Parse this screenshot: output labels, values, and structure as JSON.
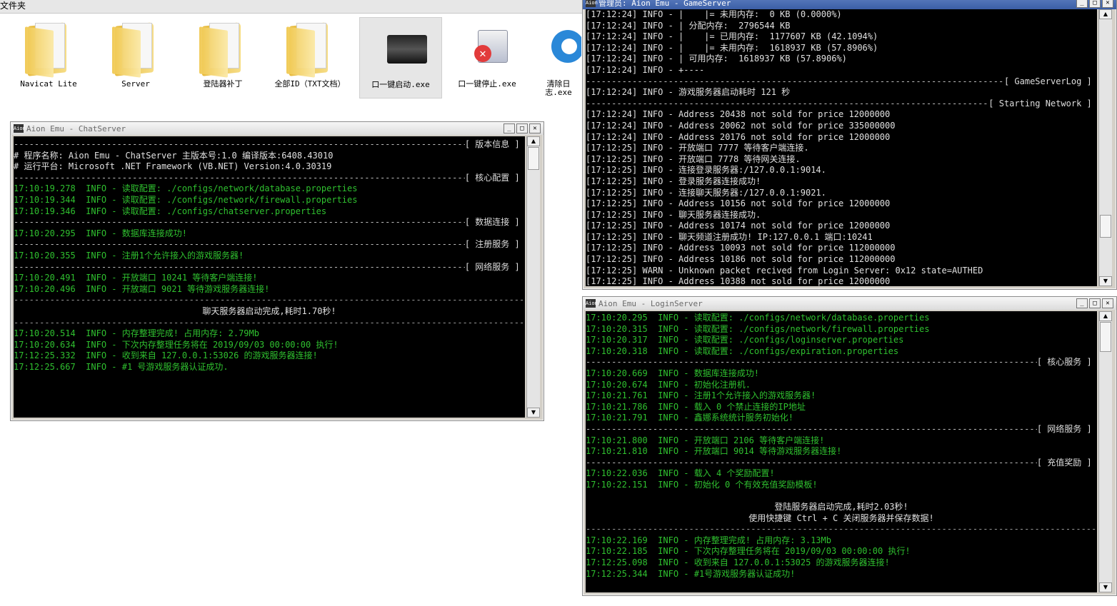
{
  "explorer": {
    "title": "文件夹",
    "icons": [
      {
        "label": "Navicat Lite",
        "kind": "folder"
      },
      {
        "label": "Server",
        "kind": "folder"
      },
      {
        "label": "登陆器补丁",
        "kind": "folder"
      },
      {
        "label": "全部ID（TXT文档）",
        "kind": "folder"
      },
      {
        "label": "口一键启动.exe",
        "kind": "servers-exe",
        "selected": true
      },
      {
        "label": "口一键停止.exe",
        "kind": "stop-exe"
      },
      {
        "label": "清除日志.exe",
        "kind": "blue-exe"
      }
    ]
  },
  "chat_window": {
    "title": "Aion Emu - ChatServer",
    "lines": [
      {
        "t": "sec",
        "text": "版本信息"
      },
      {
        "t": "txt",
        "text": "# 程序名称: Aion Emu - ChatServer 主版本号:1.0 编译版本:6408.43010"
      },
      {
        "t": "txt",
        "text": "# 运行平台: Microsoft .NET Framework (VB.NET) Version:4.0.30319"
      },
      {
        "t": "sec",
        "text": "核心配置"
      },
      {
        "t": "g",
        "text": "17:10:19.278  INFO - 读取配置: ./configs/network/database.properties"
      },
      {
        "t": "g",
        "text": "17:10:19.344  INFO - 读取配置: ./configs/network/firewall.properties"
      },
      {
        "t": "g",
        "text": "17:10:19.346  INFO - 读取配置: ./configs/chatserver.properties"
      },
      {
        "t": "sec",
        "text": "数据连接"
      },
      {
        "t": "g",
        "text": "17:10:20.295  INFO - 数据库连接成功!"
      },
      {
        "t": "sec",
        "text": "注册服务"
      },
      {
        "t": "g",
        "text": "17:10:20.355  INFO - 注册1个允许接入的游戏服务器!"
      },
      {
        "t": "sec",
        "text": "网络服务"
      },
      {
        "t": "g",
        "text": "17:10:20.491  INFO - 开放端口 10241 等待客户端连接!"
      },
      {
        "t": "g",
        "text": "17:10:20.496  INFO - 开放端口 9021 等待游戏服务器连接!"
      },
      {
        "t": "sep",
        "text": ""
      },
      {
        "t": "ctr",
        "text": "聊天服务器启动完成,耗时1.70秒!"
      },
      {
        "t": "sep",
        "text": ""
      },
      {
        "t": "g",
        "text": "17:10:20.514  INFO - 内存整理完成! 占用内存: 2.79Mb"
      },
      {
        "t": "g",
        "text": "17:10:20.634  INFO - 下次内存整理任务将在 2019/09/03 00:00:00 执行!"
      },
      {
        "t": "g",
        "text": "17:12:25.332  INFO - 收到来自 127.0.0.1:53026 的游戏服务器连接!"
      },
      {
        "t": "g",
        "text": "17:12:25.667  INFO - #1 号游戏服务器认证成功."
      }
    ]
  },
  "game_window": {
    "title": "管理员: Aion Emu - GameServer",
    "lines": [
      {
        "t": "txt",
        "text": "[17:12:24] INFO - |    |= 未用内存:  0 KB (0.0000%)"
      },
      {
        "t": "txt",
        "text": "[17:12:24] INFO - | 分配内存:  2796544 KB"
      },
      {
        "t": "txt",
        "text": "[17:12:24] INFO - |    |= 已用内存:  1177607 KB (42.1094%)"
      },
      {
        "t": "txt",
        "text": "[17:12:24] INFO - |    |= 未用内存:  1618937 KB (57.8906%)"
      },
      {
        "t": "txt",
        "text": "[17:12:24] INFO - | 可用内存:  1618937 KB (57.8906%)"
      },
      {
        "t": "txt",
        "text": "[17:12:24] INFO - +----"
      },
      {
        "t": "sec",
        "text": "GameServerLog"
      },
      {
        "t": "txt",
        "text": "[17:12:24] INFO - 游戏服务器启动耗时 121 秒"
      },
      {
        "t": "sec",
        "text": "Starting Network"
      },
      {
        "t": "txt",
        "text": "[17:12:24] INFO - Address 20438 not sold for price 12000000"
      },
      {
        "t": "txt",
        "text": "[17:12:24] INFO - Address 20062 not sold for price 335000000"
      },
      {
        "t": "txt",
        "text": "[17:12:24] INFO - Address 20176 not sold for price 12000000"
      },
      {
        "t": "txt",
        "text": "[17:12:25] INFO - 开放端口 7777 等待客户端连接."
      },
      {
        "t": "txt",
        "text": "[17:12:25] INFO - 开放端口 7778 等待网关连接."
      },
      {
        "t": "txt",
        "text": "[17:12:25] INFO - 连接登录服务器:/127.0.0.1:9014."
      },
      {
        "t": "txt",
        "text": "[17:12:25] INFO - 登录服务器连接成功!"
      },
      {
        "t": "txt",
        "text": "[17:12:25] INFO - 连接聊天服务器:/127.0.0.1:9021."
      },
      {
        "t": "txt",
        "text": "[17:12:25] INFO - Address 10156 not sold for price 12000000"
      },
      {
        "t": "txt",
        "text": "[17:12:25] INFO - 聊天服务器连接成功."
      },
      {
        "t": "txt",
        "text": "[17:12:25] INFO - Address 10174 not sold for price 12000000"
      },
      {
        "t": "txt",
        "text": "[17:12:25] INFO - 聊天频道注册成功! IP:127.0.0.1 端口:10241"
      },
      {
        "t": "txt",
        "text": "[17:12:25] INFO - Address 10093 not sold for price 112000000"
      },
      {
        "t": "txt",
        "text": "[17:12:25] INFO - Address 10186 not sold for price 112000000"
      },
      {
        "t": "txt",
        "text": "[17:12:25] WARN - Unknown packet recived from Login Server: 0x12 state=AUTHED"
      },
      {
        "t": "txt",
        "text": "[17:12:25] INFO - Address 10388 not sold for price 12000000"
      }
    ]
  },
  "login_window": {
    "title": "Aion Emu - LoginServer",
    "lines": [
      {
        "t": "g",
        "text": "17:10:20.295  INFO - 读取配置: ./configs/network/database.properties"
      },
      {
        "t": "g",
        "text": "17:10:20.315  INFO - 读取配置: ./configs/network/firewall.properties"
      },
      {
        "t": "g",
        "text": "17:10:20.317  INFO - 读取配置: ./configs/loginserver.properties"
      },
      {
        "t": "g",
        "text": "17:10:20.318  INFO - 读取配置: ./configs/expiration.properties"
      },
      {
        "t": "sec",
        "text": "核心服务"
      },
      {
        "t": "g",
        "text": "17:10:20.669  INFO - 数据库连接成功!"
      },
      {
        "t": "g",
        "text": "17:10:20.674  INFO - 初始化注册机."
      },
      {
        "t": "g",
        "text": "17:10:21.761  INFO - 注册1个允许接入的游戏服务器!"
      },
      {
        "t": "g",
        "text": "17:10:21.786  INFO - 载入 0 个禁止连接的IP地址"
      },
      {
        "t": "g",
        "text": "17:10:21.791  INFO - 鑫娜系统统计服务初始化!"
      },
      {
        "t": "sec",
        "text": "网络服务"
      },
      {
        "t": "g",
        "text": "17:10:21.800  INFO - 开放端口 2106 等待客户端连接!"
      },
      {
        "t": "g",
        "text": "17:10:21.810  INFO - 开放端口 9014 等待游戏服务器连接!"
      },
      {
        "t": "sec",
        "text": "充值奖励"
      },
      {
        "t": "g",
        "text": "17:10:22.036  INFO - 载入 4 个奖励配置!"
      },
      {
        "t": "g",
        "text": "17:10:22.151  INFO - 初始化 0 个有效充值奖励模板!"
      },
      {
        "t": "blank",
        "text": ""
      },
      {
        "t": "ctr",
        "text": "登陆服务器启动完成,耗时2.03秒!"
      },
      {
        "t": "ctr",
        "text": "使用快捷键 Ctrl + C 关闭服务器并保存数据!"
      },
      {
        "t": "sep",
        "text": ""
      },
      {
        "t": "g",
        "text": "17:10:22.169  INFO - 内存整理完成! 占用内存: 3.13Mb"
      },
      {
        "t": "g",
        "text": "17:10:22.185  INFO - 下次内存整理任务将在 2019/09/03 00:00:00 执行!"
      },
      {
        "t": "g",
        "text": "17:12:25.098  INFO - 收到来自 127.0.0.1:53025 的游戏服务器连接!"
      },
      {
        "t": "g",
        "text": "17:12:25.344  INFO - #1号游戏服务器认证成功!"
      }
    ]
  },
  "window_buttons": {
    "minimize": "_",
    "maximize": "□",
    "close": "✕"
  },
  "scroll_arrows": {
    "up": "▲",
    "down": "▼"
  },
  "app_icon_text": "Aion"
}
